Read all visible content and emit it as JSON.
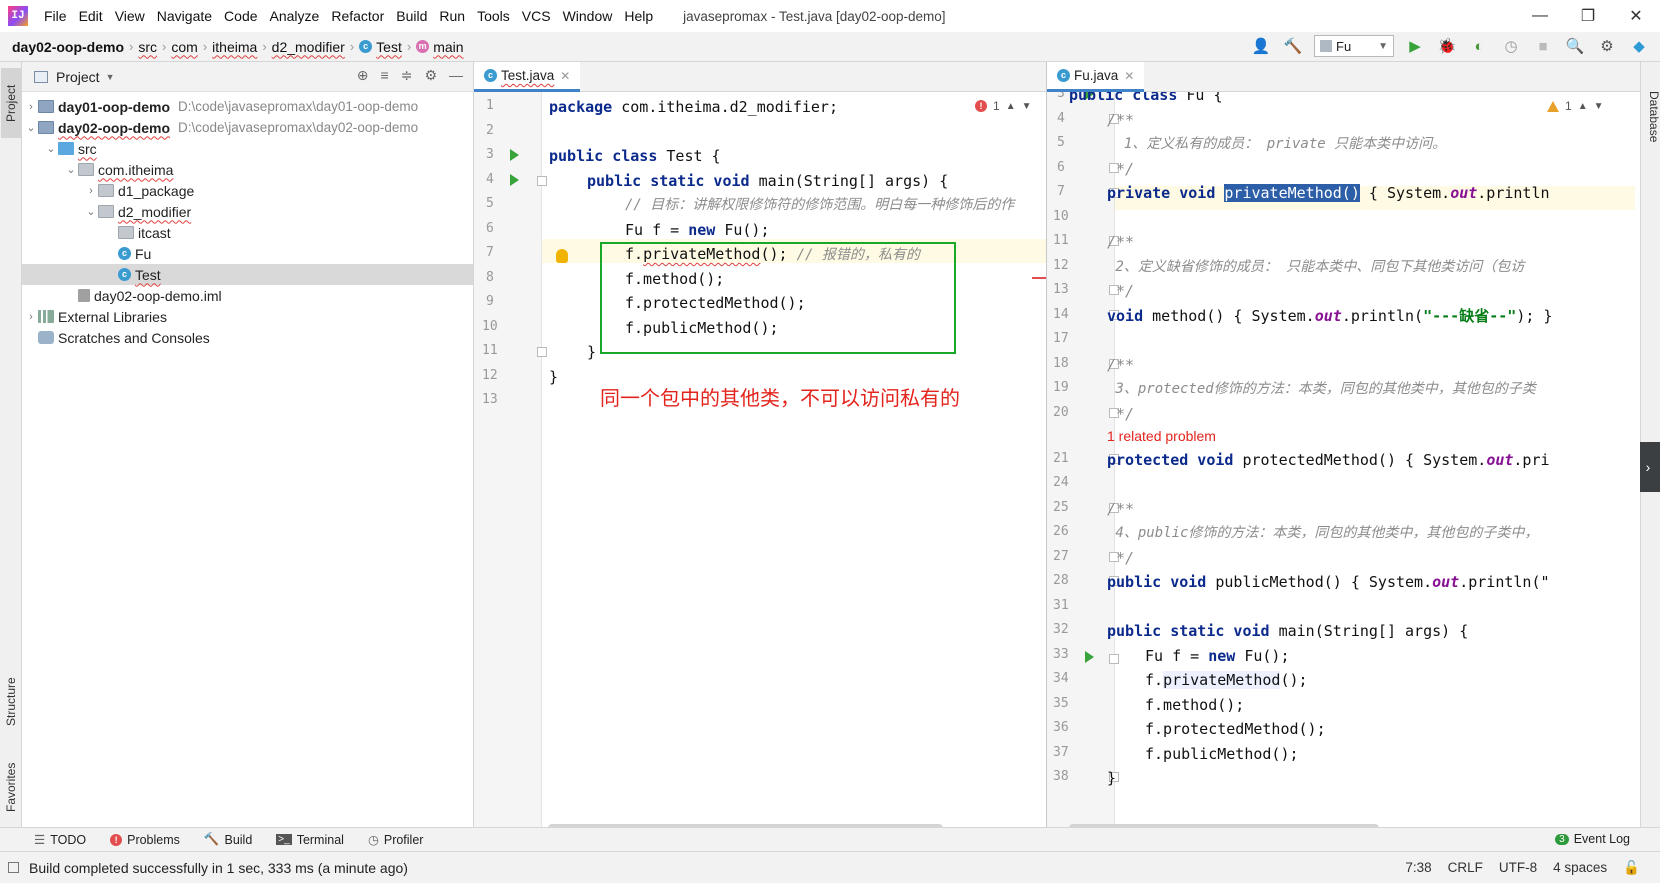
{
  "window": {
    "app_icon": "IJ",
    "title": "javasepromax - Test.java [day02-oop-demo]",
    "menus": [
      "File",
      "Edit",
      "View",
      "Navigate",
      "Code",
      "Analyze",
      "Refactor",
      "Build",
      "Run",
      "Tools",
      "VCS",
      "Window",
      "Help"
    ],
    "controls": {
      "minimize": "—",
      "restore": "❐",
      "close": "✕"
    }
  },
  "breadcrumb": [
    "day02-oop-demo",
    "src",
    "com",
    "itheima",
    "d2_modifier",
    "Test",
    "main"
  ],
  "toolbar": {
    "run_config": "Fu"
  },
  "left_strip": {
    "project": "Project",
    "structure": "Structure",
    "favorites": "Favorites"
  },
  "right_strip": {
    "database": "Database"
  },
  "project_panel": {
    "title": "Project",
    "tree": [
      {
        "label": "day01-oop-demo",
        "path": "D:\\code\\javasepromax\\day01-oop-demo"
      },
      {
        "label": "day02-oop-demo",
        "path": "D:\\code\\javasepromax\\day02-oop-demo"
      },
      {
        "label": "src"
      },
      {
        "label": "com.itheima"
      },
      {
        "label": "d1_package"
      },
      {
        "label": "d2_modifier"
      },
      {
        "label": "itcast"
      },
      {
        "label": "Fu"
      },
      {
        "label": "Test"
      },
      {
        "label": "day02-oop-demo.iml"
      },
      {
        "label": "External Libraries"
      },
      {
        "label": "Scratches and Consoles"
      }
    ]
  },
  "editor1": {
    "tab": "Test.java",
    "errors": "1",
    "line_numbers": [
      "1",
      "2",
      "3",
      "4",
      "5",
      "6",
      "7",
      "8",
      "9",
      "10",
      "11",
      "12",
      "13"
    ],
    "code": {
      "l1_kw": "package",
      "l1_rest": " com.itheima.d2_modifier;",
      "l3_kw": "public class",
      "l3_rest": " Test {",
      "l4_kw1": "public static void",
      "l4_rest": " main(String[] args) {",
      "l5_cmt": "// 目标：讲解权限修饰符的修饰范围。明白每一种修饰后的作",
      "l6_a": "Fu f = ",
      "l6_kw": "new",
      "l6_b": " Fu();",
      "l7_a": "f.",
      "l7_b": "privateMethod",
      "l7_c": "(); ",
      "l7_cmt": "// 报错的，私有的",
      "l8": "f.method();",
      "l9": "f.protectedMethod();",
      "l10": "f.publicMethod();",
      "l11": "}",
      "l12": "}"
    },
    "annotation": "同一个包中的其他类，不可以访问私有的"
  },
  "editor2": {
    "tab": "Fu.java",
    "warnings": "1",
    "line_numbers": [
      "3",
      "4",
      "5",
      "6",
      "7",
      "10",
      "11",
      "12",
      "13",
      "14",
      "17",
      "18",
      "19",
      "20",
      "",
      "21",
      "24",
      "25",
      "26",
      "27",
      "28",
      "31",
      "32",
      "33",
      "34",
      "35",
      "36",
      "37",
      "38"
    ],
    "code": {
      "l3_kw": "public class",
      "l3_rest": " Fu {",
      "l4": "/**",
      "l5": "  1、定义私有的成员： private 只能本类中访问。",
      "l6": " */",
      "l7_kw": "private void",
      "l7_m": "privateMethod()",
      "l7_a": " { System.",
      "l7_f": "out",
      "l7_b": ".println",
      "l11": "/**",
      "l12": " 2、定义缺省修饰的成员： 只能本类中、同包下其他类访问（包访",
      "l13": " */",
      "l14_kw": "void",
      "l14_a": " method() { System.",
      "l14_f": "out",
      "l14_b": ".println(",
      "l14_s": "\"---缺省--\"",
      "l14_c": "); }",
      "l18": "/**",
      "l19": " 3、protected修饰的方法：本类，同包的其他类中，其他包的子类",
      "l20": " */",
      "related": "1 related problem",
      "l21_kw": "protected void",
      "l21_a": " protectedMethod() { System.",
      "l21_f": "out",
      "l21_b": ".pri",
      "l25": "/**",
      "l26": " 4、public修饰的方法：本类，同包的其他类中，其他包的子类中，",
      "l27": " */",
      "l28_kw": "public void",
      "l28_a": " publicMethod() { System.",
      "l28_f": "out",
      "l28_b": ".println(\"",
      "l32_kw": "public static void",
      "l32_rest": " main(String[] args) {",
      "l33_a": "Fu f = ",
      "l33_kw": "new",
      "l33_b": " Fu();",
      "l34_a": "f.",
      "l34_b": "privateMethod",
      "l34_c": "();",
      "l35": "f.method();",
      "l36": "f.protectedMethod();",
      "l37": "f.publicMethod();",
      "l38": "}"
    }
  },
  "bottom_tools": [
    "TODO",
    "Problems",
    "Build",
    "Terminal",
    "Profiler"
  ],
  "event_log": {
    "count": "3",
    "label": "Event Log"
  },
  "status": {
    "message": "Build completed successfully in 1 sec, 333 ms (a minute ago)",
    "position": "7:38",
    "line_sep": "CRLF",
    "encoding": "UTF-8",
    "indent": "4 spaces"
  }
}
